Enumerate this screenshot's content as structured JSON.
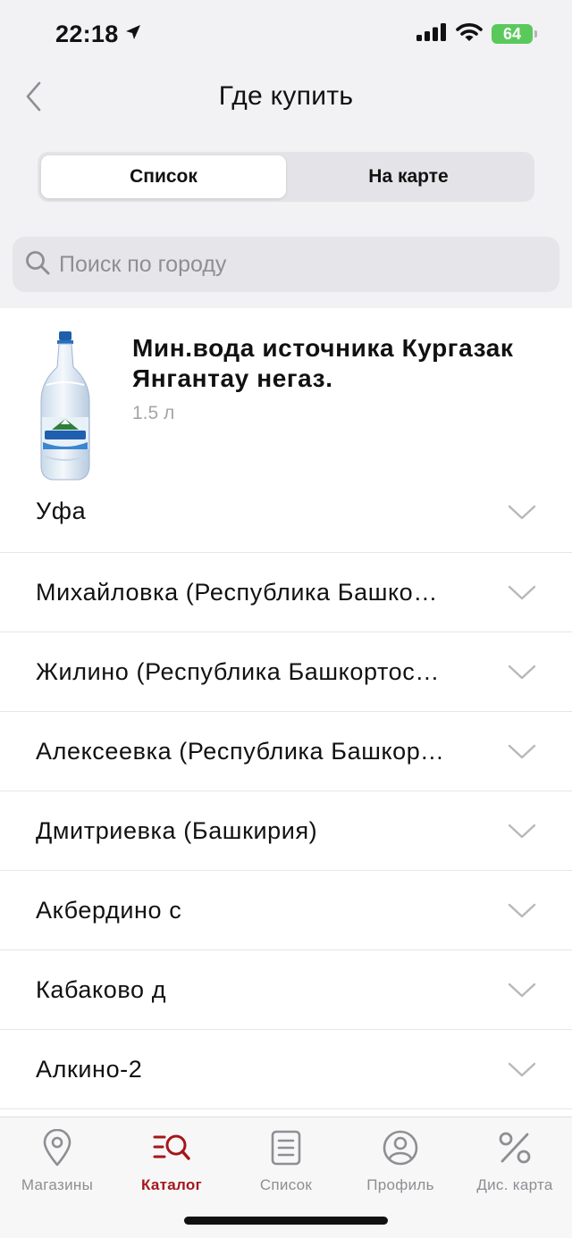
{
  "status_bar": {
    "time": "22:18",
    "battery": "64"
  },
  "nav": {
    "title": "Где купить"
  },
  "segments": [
    {
      "label": "Список",
      "active": true
    },
    {
      "label": "На карте",
      "active": false
    }
  ],
  "search": {
    "placeholder": "Поиск по городу",
    "value": ""
  },
  "product": {
    "name": "Мин.вода источника Кургазак Янгантау негаз.",
    "volume": "1.5 л",
    "image_label": "Кургазак"
  },
  "cities": [
    "Уфа",
    "Михайловка (Республика Башкортостан)",
    "Жилино (Республика Башкортостан)",
    "Алексеевка (Республика Башкортостан)",
    "Дмитриевка (Башкирия)",
    "Акбердино с",
    "Кабаково д",
    "Алкино-2"
  ],
  "tabs": [
    {
      "label": "Магазины",
      "icon": "map-pin-icon",
      "active": false
    },
    {
      "label": "Каталог",
      "icon": "catalog-search-icon",
      "active": true
    },
    {
      "label": "Список",
      "icon": "list-document-icon",
      "active": false
    },
    {
      "label": "Профиль",
      "icon": "profile-icon",
      "active": false
    },
    {
      "label": "Дис. карта",
      "icon": "percent-icon",
      "active": false
    }
  ],
  "colors": {
    "accent": "#a4161a",
    "inactive": "#8e8e93",
    "battery": "#5ac95c"
  }
}
